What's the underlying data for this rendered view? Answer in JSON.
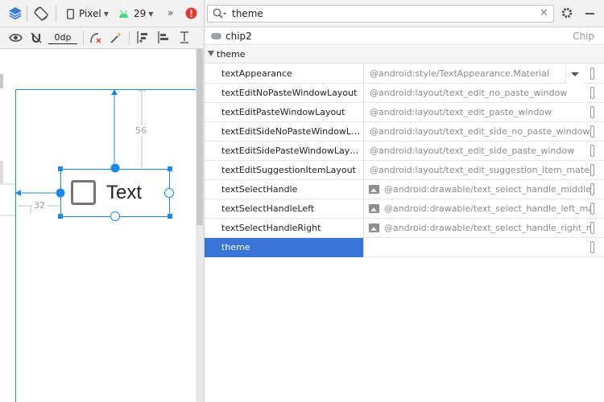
{
  "design_toolbar": {
    "device_label": "Pixel",
    "api_label": "29",
    "margin_value": "0dp"
  },
  "canvas": {
    "text_view_label": "Text",
    "dimension_top": "56",
    "dimension_left": "32"
  },
  "attributes": {
    "search_value": "theme",
    "component_id": "chip2",
    "component_class": "Chip",
    "section_title": "theme",
    "rows": [
      {
        "name": "textAppearance",
        "value": "@android:style/TextAppearance.Material"
      },
      {
        "name": "textEditNoPasteWindowLayout",
        "value": "@android:layout/text_edit_no_paste_window"
      },
      {
        "name": "textEditPasteWindowLayout",
        "value": "@android:layout/text_edit_paste_window"
      },
      {
        "name": "textEditSideNoPasteWindowLay...",
        "value": "@android:layout/text_edit_side_no_paste_window"
      },
      {
        "name": "textEditSidePasteWindowLayout",
        "value": "@android:layout/text_edit_side_paste_window"
      },
      {
        "name": "textEditSuggestionItemLayout",
        "value": "@android:layout/text_edit_suggestion_item_mater"
      },
      {
        "name": "textSelectHandle",
        "value": "@android:drawable/text_select_handle_middle_"
      },
      {
        "name": "textSelectHandleLeft",
        "value": "@android:drawable/text_select_handle_left_ma"
      },
      {
        "name": "textSelectHandleRight",
        "value": "@android:drawable/text_select_handle_right_m"
      },
      {
        "name": "theme",
        "value": ""
      }
    ]
  },
  "colors": {
    "selection": "#3875d7",
    "blueprint": "#1e88e5",
    "error": "#e53935",
    "android_green": "#3ddc84"
  },
  "icons": [
    "layers-icon",
    "rotate-device-icon",
    "phone-icon",
    "android-icon",
    "overflow-icon",
    "error-icon",
    "eye-icon",
    "magnet-off-icon",
    "clear-constraints-icon",
    "magic-wand-icon",
    "pack-icon",
    "align-icon",
    "guidelines-icon",
    "search-icon",
    "clear-icon",
    "gear-icon"
  ]
}
